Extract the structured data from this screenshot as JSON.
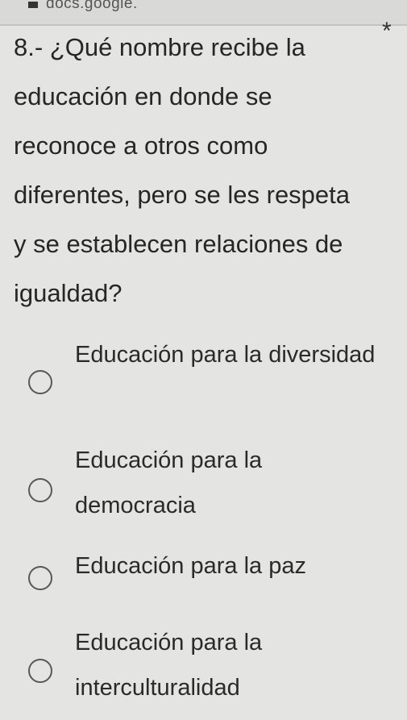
{
  "browser": {
    "url": "docs.google."
  },
  "question": {
    "text": "8.- ¿Qué nombre recibe la educación en donde se reconoce a otros como diferentes, pero se les respeta y se establecen relaciones de igualdad?",
    "required_marker": "*"
  },
  "options": [
    {
      "label": "Educación para la diversidad"
    },
    {
      "label": "Educación para la democracia"
    },
    {
      "label": "Educación para la paz"
    },
    {
      "label": "Educación para la interculturalidad"
    }
  ]
}
